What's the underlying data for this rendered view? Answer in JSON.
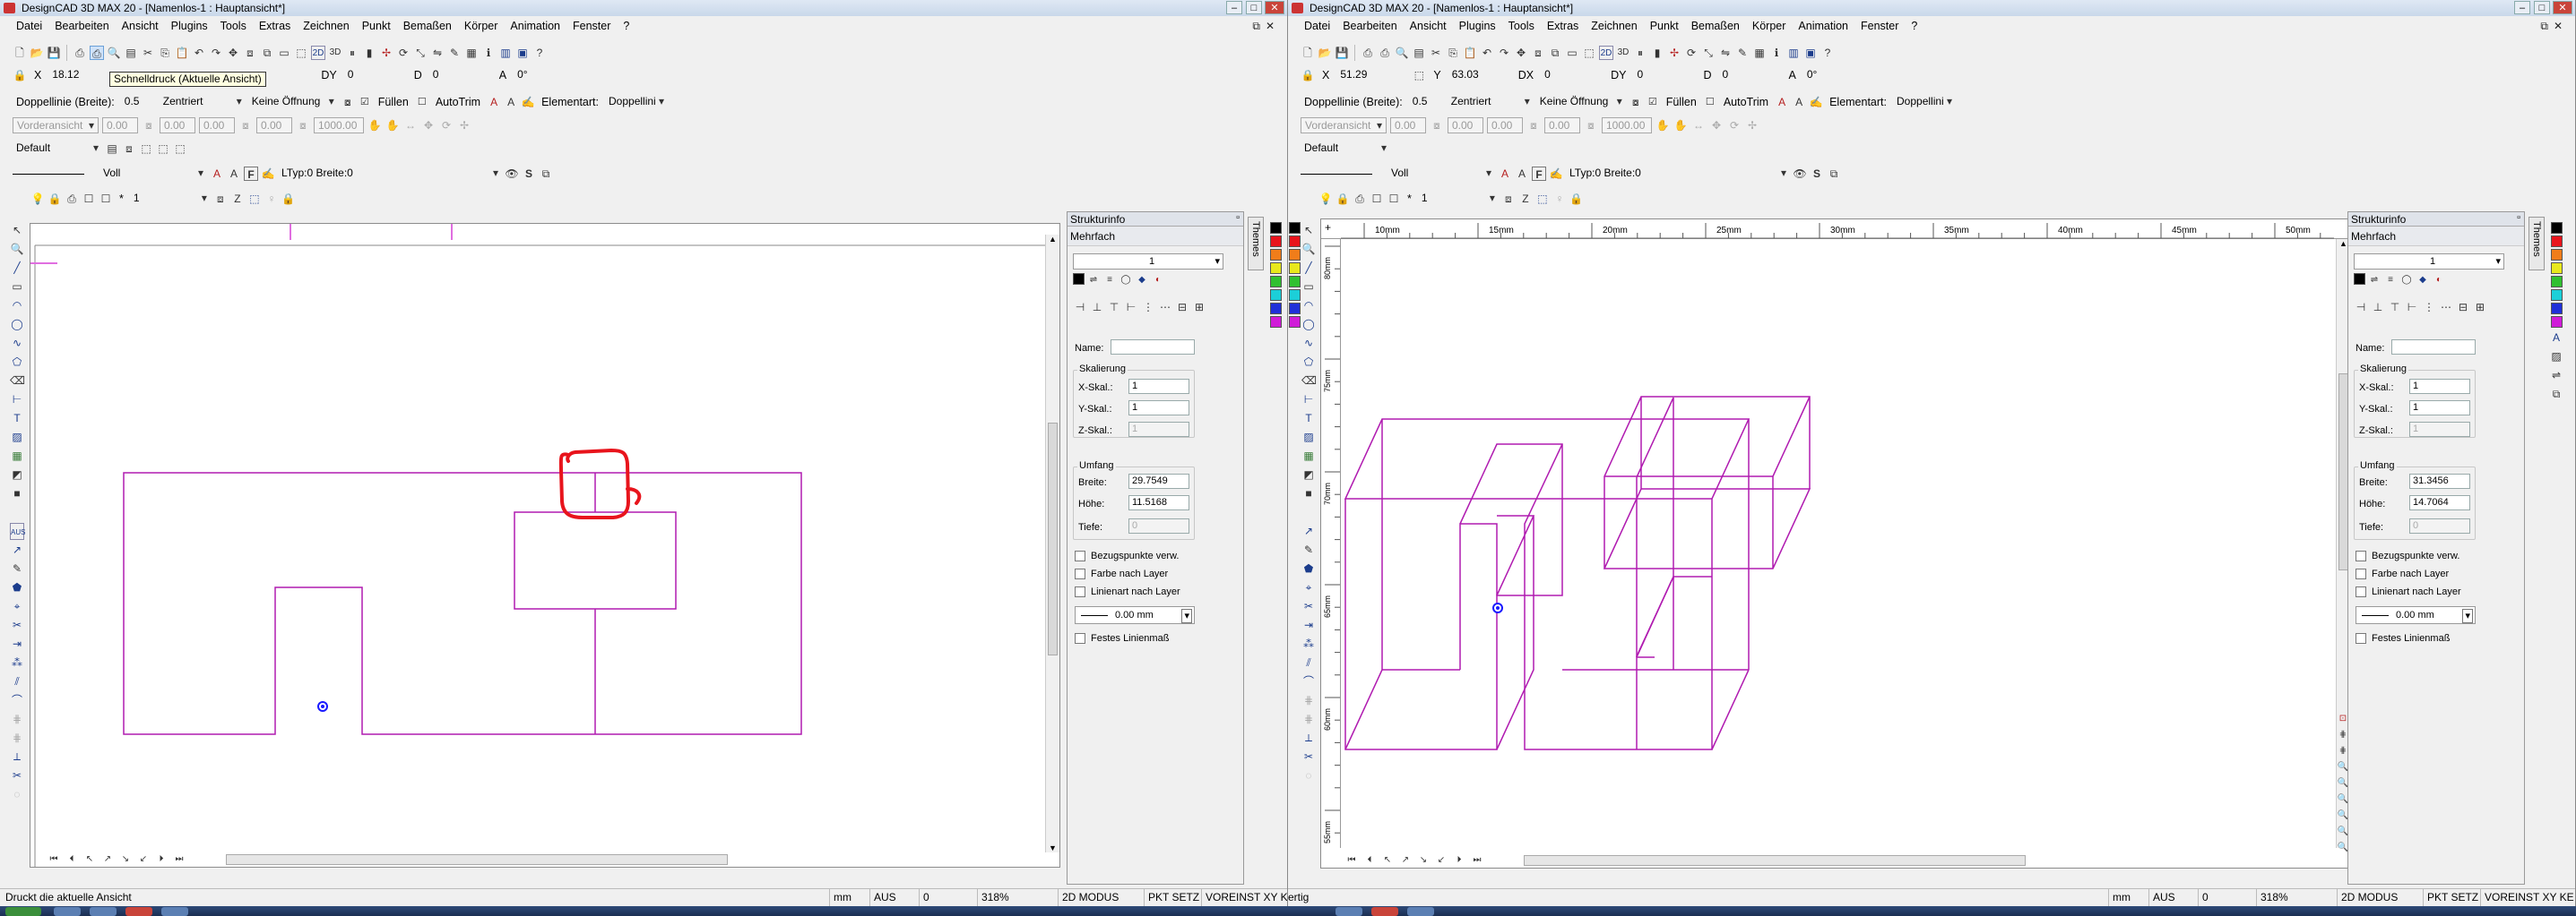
{
  "left": {
    "title": "DesignCAD 3D MAX 20 - [Namenlos-1 : Hauptansicht*]",
    "menu": [
      "Datei",
      "Bearbeiten",
      "Ansicht",
      "Plugins",
      "Tools",
      "Extras",
      "Zeichnen",
      "Punkt",
      "Bemaßen",
      "Körper",
      "Animation",
      "Fenster",
      "?"
    ],
    "coords": {
      "x_label": "X",
      "x_value": "18.12",
      "dy_label": "DY",
      "dy_value": "0",
      "d_label": "D",
      "d_value": "0",
      "a_label": "A",
      "a_value": "0°"
    },
    "tooltip": "Schnelldruck (Aktuelle Ansicht)",
    "row3": {
      "line_width_label": "Doppellinie (Breite):",
      "line_width_value": "0.5",
      "align": "Zentriert",
      "opening": "Keine Öffnung",
      "fill_label": "Füllen",
      "autotrim_label": "AutoTrim",
      "element_type_label": "Elementart:",
      "element_type_value": "Doppellini"
    },
    "row4": {
      "view": "Vorderansicht",
      "v1": "0.00",
      "v2": "0.00",
      "v3": "0.00",
      "v4": "0.00",
      "v5": "1000.00"
    },
    "layer_default": "Default",
    "line_style": {
      "style": "Voll",
      "ltype": "LTyp:0  Breite:0"
    },
    "layer_number": "1",
    "panel": {
      "title": "Strukturinfo",
      "subtitle": "Mehrfach",
      "combo_value": "1",
      "name_label": "Name:",
      "scale_group": "Skalierung",
      "x_scale_label": "X-Skal.:",
      "x_scale_value": "1",
      "y_scale_label": "Y-Skal.:",
      "y_scale_value": "1",
      "z_scale_label": "Z-Skal.:",
      "z_scale_value": "1",
      "extent_group": "Umfang",
      "width_label": "Breite:",
      "width_value": "29.7549",
      "height_label": "Höhe:",
      "height_value": "11.5168",
      "depth_label": "Tiefe:",
      "depth_value": "0",
      "cb1": "Bezugspunkte verw.",
      "cb2": "Farbe nach Layer",
      "cb3": "Linienart nach Layer",
      "line_width": "0.00 mm",
      "cb4": "Festes Linienmaß"
    },
    "themes_tab": "Themes",
    "status": {
      "message": "Druckt die aktuelle Ansicht",
      "unit": "mm",
      "aus": "AUS",
      "zero": "0",
      "zoom": "318%",
      "mode": "2D MODUS",
      "pkt": "PKT SETZ",
      "voreinst": "VOREINST XY KE"
    }
  },
  "right": {
    "title": "DesignCAD 3D MAX 20 - [Namenlos-1 : Hauptansicht*]",
    "menu": [
      "Datei",
      "Bearbeiten",
      "Ansicht",
      "Plugins",
      "Tools",
      "Extras",
      "Zeichnen",
      "Punkt",
      "Bemaßen",
      "Körper",
      "Animation",
      "Fenster",
      "?"
    ],
    "coords": {
      "x_label": "X",
      "x_value": "51.29",
      "y_label": "Y",
      "y_value": "63.03",
      "dx_label": "DX",
      "dx_value": "0",
      "dy_label": "DY",
      "dy_value": "0",
      "d_label": "D",
      "d_value": "0",
      "a_label": "A",
      "a_value": "0°"
    },
    "row3": {
      "line_width_label": "Doppellinie (Breite):",
      "line_width_value": "0.5",
      "align": "Zentriert",
      "opening": "Keine Öffnung",
      "fill_label": "Füllen",
      "autotrim_label": "AutoTrim",
      "element_type_label": "Elementart:",
      "element_type_value": "Doppellini"
    },
    "row4": {
      "view": "Vorderansicht",
      "v1": "0.00",
      "v2": "0.00",
      "v3": "0.00",
      "v4": "0.00",
      "v5": "1000.00"
    },
    "layer_default": "Default",
    "line_style": {
      "style": "Voll",
      "ltype": "LTyp:0  Breite:0"
    },
    "layer_number": "1",
    "ruler_top": [
      "10mm",
      "15mm",
      "20mm",
      "25mm",
      "30mm",
      "35mm",
      "40mm",
      "45mm",
      "50mm"
    ],
    "ruler_left": [
      "80mm",
      "75mm",
      "70mm",
      "65mm",
      "60mm",
      "55mm"
    ],
    "panel": {
      "title": "Strukturinfo",
      "subtitle": "Mehrfach",
      "combo_value": "1",
      "name_label": "Name:",
      "scale_group": "Skalierung",
      "x_scale_label": "X-Skal.:",
      "x_scale_value": "1",
      "y_scale_label": "Y-Skal.:",
      "y_scale_value": "1",
      "z_scale_label": "Z-Skal.:",
      "z_scale_value": "1",
      "extent_group": "Umfang",
      "width_label": "Breite:",
      "width_value": "31.3456",
      "height_label": "Höhe:",
      "height_value": "14.7064",
      "depth_label": "Tiefe:",
      "depth_value": "0",
      "cb1": "Bezugspunkte verw.",
      "cb2": "Farbe nach Layer",
      "cb3": "Linienart nach Layer",
      "line_width": "0.00 mm",
      "cb4": "Festes Linienmaß"
    },
    "themes_tab": "Themes",
    "status": {
      "message": "ertig",
      "unit": "mm",
      "aus": "AUS",
      "zero": "0",
      "zoom": "318%",
      "mode": "2D MODUS",
      "pkt": "PKT SETZ",
      "voreinst": "VOREINST XY KE"
    }
  },
  "colors": {
    "geometry": "#b01bb0",
    "annotation": "#e8141c",
    "point": "#1a1aff",
    "palette": [
      "#000000",
      "#e8141c",
      "#f07d1a",
      "#e8e81c",
      "#30c030",
      "#1ccfd8",
      "#2030d8",
      "#d01cd8"
    ]
  }
}
